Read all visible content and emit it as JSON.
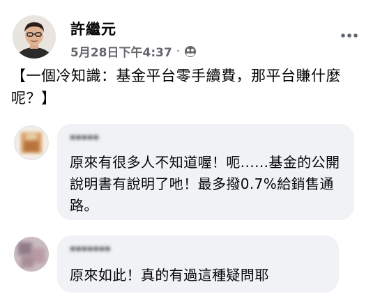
{
  "post": {
    "author_name": "許繼元",
    "timestamp": "5月28日下午4:37",
    "separator": "·",
    "privacy_icon": "friends-icon",
    "more_icon": "more-horizontal-icon",
    "text": "【一個冷知識：基金平台零手續費，那平台賺什麼呢？】"
  },
  "comments": [
    {
      "author_name": "*****",
      "text": "原來有很多人不知道喔！呃......基金的公開說明書有說明了吔！最多撥0.7%給銷售通路。"
    },
    {
      "author_name": "*******",
      "text": "原來如此！真的有過這種疑問耶"
    }
  ]
}
